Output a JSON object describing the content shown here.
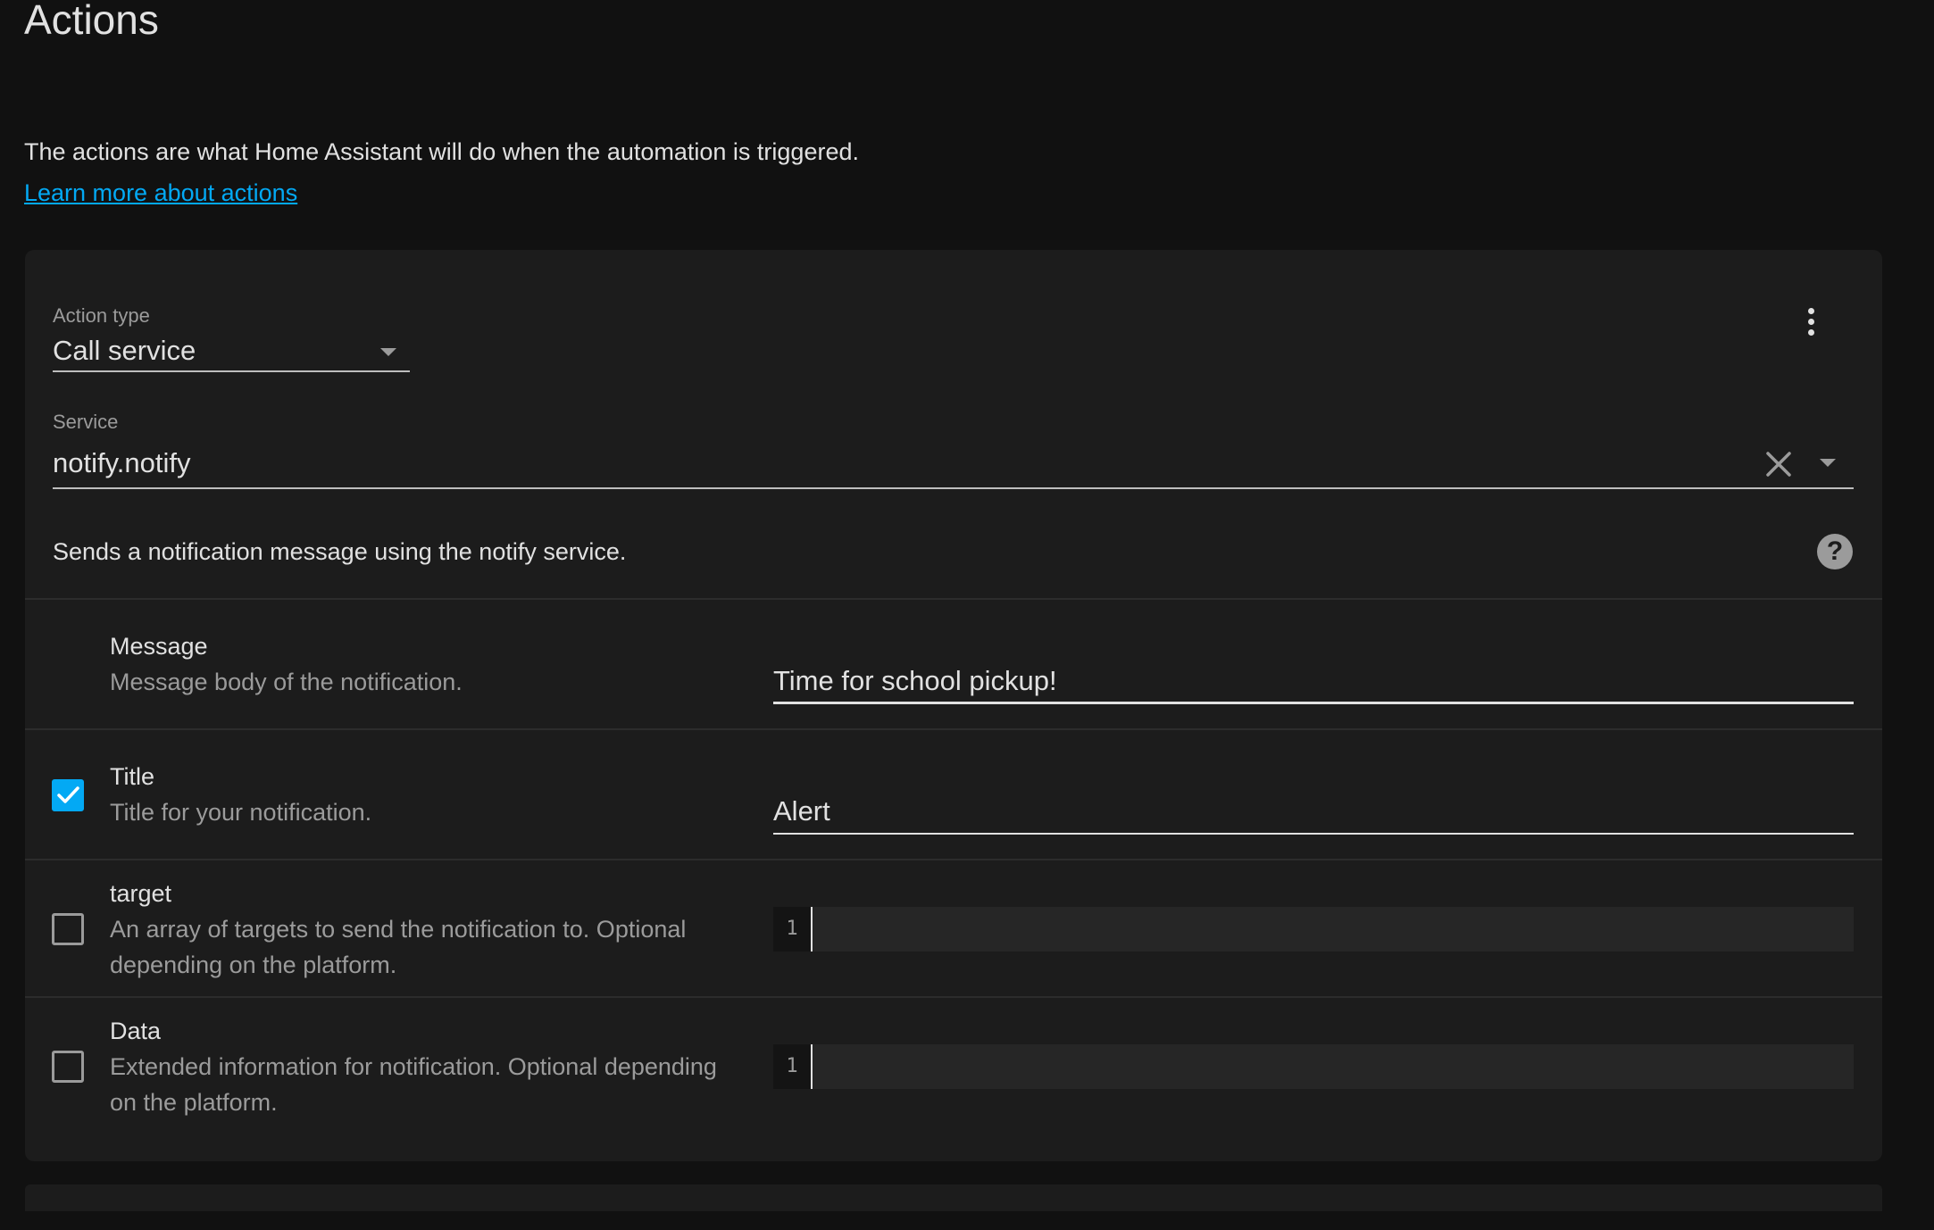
{
  "header": {
    "title": "Actions",
    "intro": "The actions are what Home Assistant will do when the automation is triggered.",
    "learn_more": "Learn more about actions"
  },
  "action": {
    "type_label": "Action type",
    "type_value": "Call service",
    "service_label": "Service",
    "service_value": "notify.notify",
    "service_description": "Sends a notification message using the notify service."
  },
  "fields": [
    {
      "name": "Message",
      "help": "Message body of the notification.",
      "value": "Time for school pickup!",
      "enabled": true,
      "has_checkbox": false
    },
    {
      "name": "Title",
      "help": "Title for your notification.",
      "value": "Alert",
      "enabled": true,
      "has_checkbox": true
    },
    {
      "name": "target",
      "help": "An array of targets to send the notification to. Optional depending on the platform.",
      "line_number": "1",
      "enabled": false,
      "has_checkbox": true
    },
    {
      "name": "Data",
      "help": "Extended information for notification. Optional depending on the platform.",
      "line_number": "1",
      "enabled": false,
      "has_checkbox": true
    }
  ],
  "icons": {
    "overflow": "dots-vertical-icon",
    "clear": "close-icon",
    "help": "help-circle-icon",
    "dropdown": "menu-down-icon",
    "check": "check-icon"
  },
  "colors": {
    "background": "#111111",
    "card": "#1c1c1c",
    "accent": "#03a9f4",
    "text_primary": "#e1e1e1",
    "text_secondary": "#9b9b9b"
  }
}
